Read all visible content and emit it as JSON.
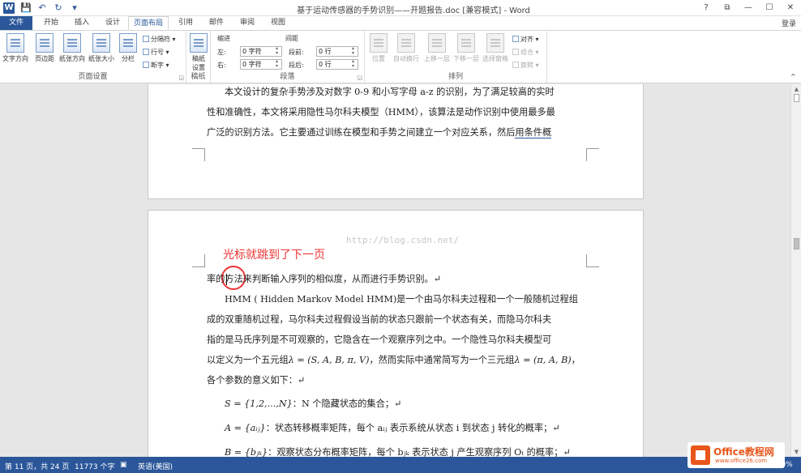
{
  "window": {
    "title": "基于运动传感器的手势识别——开题报告.doc [兼容模式] - Word",
    "controls": [
      "?",
      "⧉",
      "—",
      "☐",
      "✕"
    ],
    "login": "登录"
  },
  "tabs": [
    {
      "label": "文件",
      "name": "tab-file"
    },
    {
      "label": "开始",
      "name": "tab-home"
    },
    {
      "label": "插入",
      "name": "tab-insert"
    },
    {
      "label": "设计",
      "name": "tab-design"
    },
    {
      "label": "页面布局",
      "name": "tab-page-layout"
    },
    {
      "label": "引用",
      "name": "tab-references"
    },
    {
      "label": "邮件",
      "name": "tab-mailings"
    },
    {
      "label": "审阅",
      "name": "tab-review"
    },
    {
      "label": "视图",
      "name": "tab-view"
    }
  ],
  "ribbon": {
    "page_setup": {
      "label": "页面设置",
      "text_direction": "文字方向",
      "margins": "页边距",
      "orientation": "纸张方向",
      "size": "纸张大小",
      "columns": "分栏",
      "breaks": "分隔符 ▾",
      "line_numbers": "行号 ▾",
      "hyphenation": "断字 ▾"
    },
    "draft": {
      "label": "稿纸",
      "button_line1": "稿纸",
      "button_line2": "设置"
    },
    "paragraph": {
      "label": "段落",
      "indent_head": "缩进",
      "spacing_head": "间距",
      "left_label": "左:",
      "right_label": "右:",
      "before_label": "段前:",
      "after_label": "段后:",
      "left_value": "0 字符",
      "right_value": "0 字符",
      "before_value": "0 行",
      "after_value": "0 行"
    },
    "arrange": {
      "label": "排列",
      "position": "位置",
      "wrap_text": "自动换行",
      "bring_forward": "上移一层",
      "send_backward": "下移一层",
      "selection_pane": "选择窗格",
      "align": "对齐 ▾",
      "group": "组合 ▾",
      "rotate": "旋转 ▾"
    }
  },
  "document": {
    "page1_lines": [
      "本文设计的复杂手势涉及对数字 0-9 和小写字母 a-z 的识别，为了满足较高的实时",
      "性和准确性，本文将采用隐性马尔科夫模型（HMM），该算法是动作识别中使用最多最",
      "广泛的识别方法。它主要通过训练在模型和手势之间建立一个对应关系，然后"
    ],
    "page1_underlined": "用条件概",
    "annotation": "光标就跳到了下一页",
    "watermark": "http://blog.csdn.net/",
    "line1": "率的方法来判断输入序列的相似度，从而进行手势识别。↵",
    "hmm_lines": [
      "HMM ( Hidden Markov Model HMM)是一个由马尔科夫过程和一个一般随机过程组",
      "成的双重随机过程，马尔科夫过程假设当前的状态只跟前一个状态有关，而隐马尔科夫",
      "指的是马氏序列是不可观察的，它隐含在一个观察序列之中。一个隐性马尔科夫模型可"
    ],
    "five_tuple_prefix": "以定义为一个五元组",
    "five_tuple": "λ = (S, A, B, π, V)",
    "five_tuple_mid": "，然而实际中通常简写为一个三元组",
    "three_tuple": "λ = (π, A, B)",
    "five_tuple_suffix": "，",
    "params_intro": "各个参数的意义如下：↵",
    "param_s_formula": "S = {1,2,...,N}",
    "param_s_text": "：N 个隐藏状态的集合；↵",
    "param_a_formula": "A = {aᵢⱼ}",
    "param_a_text": "：状态转移概率矩阵，每个 aᵢⱼ 表示系统从状态 i 到状态 j 转化的概率；↵",
    "param_b_formula": "B = {bⱼₖ}",
    "param_b_text": "：观察状态分布概率矩阵，每个 bⱼₖ 表示状态 j 产生观察序列 Oₜ 的概率；↵"
  },
  "status": {
    "page": "第 11 页，共 24 页",
    "words": "11773 个字",
    "lang": "英语(美国)",
    "zoom": "110%"
  },
  "logo": {
    "text": "Office教程网",
    "url": "www.office26.com"
  },
  "colors": {
    "accent": "#2b579a",
    "annotation": "#e33333",
    "logo": "#e8561c"
  }
}
